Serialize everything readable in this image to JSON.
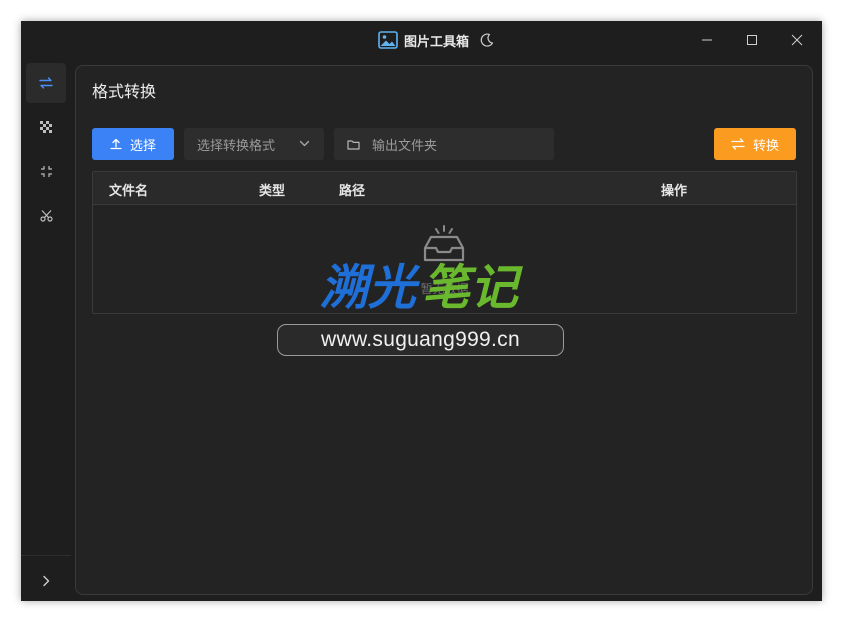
{
  "window": {
    "title": "图片工具箱"
  },
  "sidebar": {
    "items": [
      {
        "icon": "convert-arrows-icon",
        "active": true
      },
      {
        "icon": "mosaic-icon",
        "active": false
      },
      {
        "icon": "compress-icon",
        "active": false
      },
      {
        "icon": "scissors-icon",
        "active": false
      }
    ],
    "expand_icon": "chevron-right-icon"
  },
  "main": {
    "title": "格式转换",
    "toolbar": {
      "select_label": "选择",
      "format_placeholder": "选择转换格式",
      "output_placeholder": "输出文件夹",
      "convert_label": "转换"
    },
    "table": {
      "columns": [
        "文件名",
        "类型",
        "路径",
        "操作"
      ],
      "empty_text": "暂无数据"
    }
  },
  "watermark": {
    "logo_text": "溯光笔记",
    "url": "www.suguang999.cn"
  },
  "colors": {
    "primary": "#3b82f6",
    "accent": "#fb9b1f",
    "background": "#1e1e1e",
    "panel": "#232323",
    "logo_blue": "#1f6fd8",
    "logo_green": "#6ab82e"
  }
}
